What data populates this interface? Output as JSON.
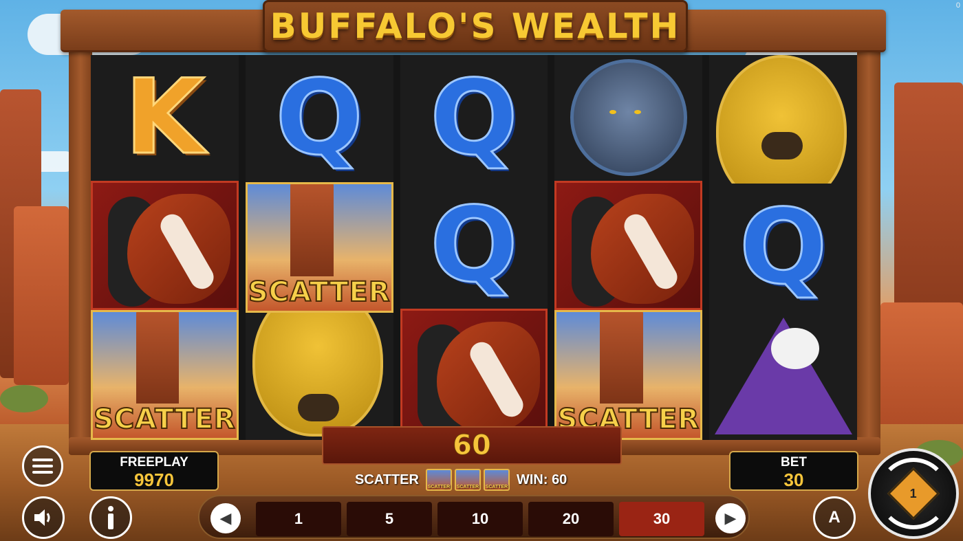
{
  "game": {
    "title": "BUFFALO'S WEALTH"
  },
  "reels": [
    [
      "K",
      "horse",
      "scatter"
    ],
    [
      "Q",
      "scatter",
      "buffalo"
    ],
    [
      "Q",
      "Q",
      "horse"
    ],
    [
      "panther",
      "horse",
      "scatter"
    ],
    [
      "buffalo",
      "Q",
      "eagle"
    ]
  ],
  "symbols": {
    "scatter_label": "SCATTER"
  },
  "win": {
    "amount": "60",
    "symbol_label": "SCATTER",
    "mini_label": "SCATTER",
    "win_text": "WIN: 60"
  },
  "balance": {
    "label": "FREEPLAY",
    "value": "9970"
  },
  "bet": {
    "label": "BET",
    "value": "30",
    "options": [
      "1",
      "5",
      "10",
      "20",
      "30"
    ],
    "selected": "30"
  },
  "spin": {
    "core_label": "1"
  },
  "auto": {
    "label": "A"
  },
  "corner": {
    "value": "0"
  },
  "colors": {
    "gold": "#f6c53b",
    "selected_bet": "#9a2414",
    "reel_bg": "#151515"
  }
}
